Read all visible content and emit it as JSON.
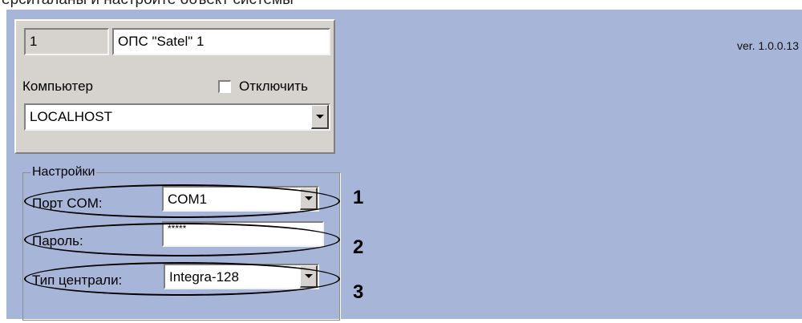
{
  "cropped_heading": "ерситаланы и настройте объект системы",
  "object_box": {
    "id_value": "1",
    "name_value": "ОПС \"Satel\" 1",
    "computer_label": "Компьютер",
    "disable_checkbox_label": "Отключить",
    "disable_checked": false,
    "computer_value": "LOCALHOST"
  },
  "version": "ver. 1.0.0.13",
  "settings": {
    "group_label": "Настройки",
    "port_label": "Порт COM:",
    "port_value": "COM1",
    "password_label": "Пароль:",
    "password_value": "*****",
    "panel_type_label": "Тип централи:",
    "panel_type_value": "Integra-128"
  },
  "callouts": [
    "1",
    "2",
    "3"
  ],
  "colors": {
    "panel_bg": "#a7b5d9",
    "control_face": "#d6d3ce",
    "field_bg": "#ffffff"
  }
}
